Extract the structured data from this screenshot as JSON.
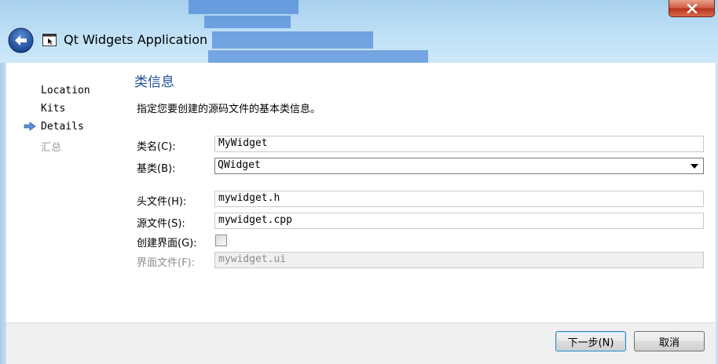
{
  "window": {
    "title": "Qt Widgets Application"
  },
  "sidebar": {
    "steps": [
      {
        "label": "Location",
        "state": "done"
      },
      {
        "label": "Kits",
        "state": "done"
      },
      {
        "label": "Details",
        "state": "current"
      },
      {
        "label": "汇总",
        "state": "future"
      }
    ]
  },
  "page": {
    "title": "类信息",
    "description": "指定您要创建的源码文件的基本类信息。"
  },
  "form": {
    "class_name_label": "类名(C):",
    "class_name_value": "MyWidget",
    "base_class_label": "基类(B):",
    "base_class_value": "QWidget",
    "header_label": "头文件(H):",
    "header_value": "mywidget.h",
    "source_label": "源文件(S):",
    "source_value": "mywidget.cpp",
    "create_form_label": "创建界面(G):",
    "create_form_checked": false,
    "form_file_label": "界面文件(F):",
    "form_file_value": "mywidget.ui"
  },
  "buttons": {
    "next_label": "下一步(N)",
    "cancel_label": "取消"
  },
  "colors": {
    "title_accent": "#1f4e9c",
    "disabled_text": "#8c8c8c",
    "close_button": "#c8452a"
  }
}
